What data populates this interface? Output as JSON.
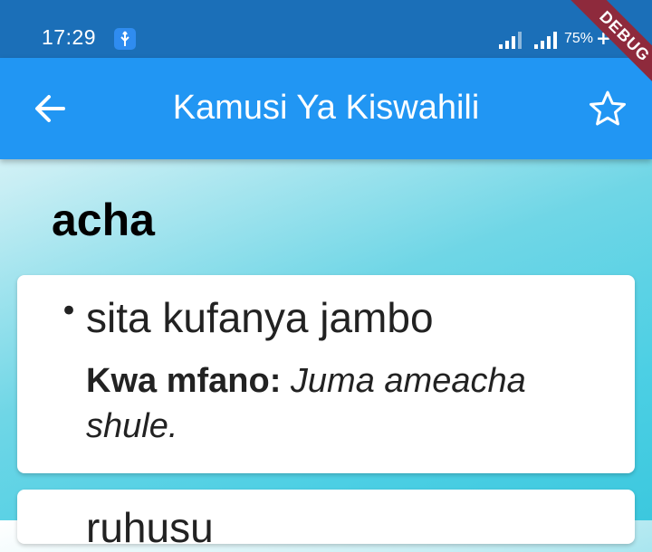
{
  "status_bar": {
    "time": "17:29",
    "battery": "75%",
    "icons": [
      "usb-icon",
      "signal-icon",
      "signal-icon",
      "battery-charging-icon"
    ]
  },
  "app_bar": {
    "title": "Kamusi Ya Kiswahili",
    "back_icon": "arrow-left-icon",
    "favorite_icon": "star-outline-icon",
    "color": "#2196f3"
  },
  "debug_banner": "DEBUG",
  "word": "acha",
  "definitions": [
    {
      "meaning": "sita kufanya jambo",
      "example_label": "Kwa mfano:",
      "example_text": "Juma ameacha shule."
    },
    {
      "meaning": "ruhusu"
    }
  ]
}
